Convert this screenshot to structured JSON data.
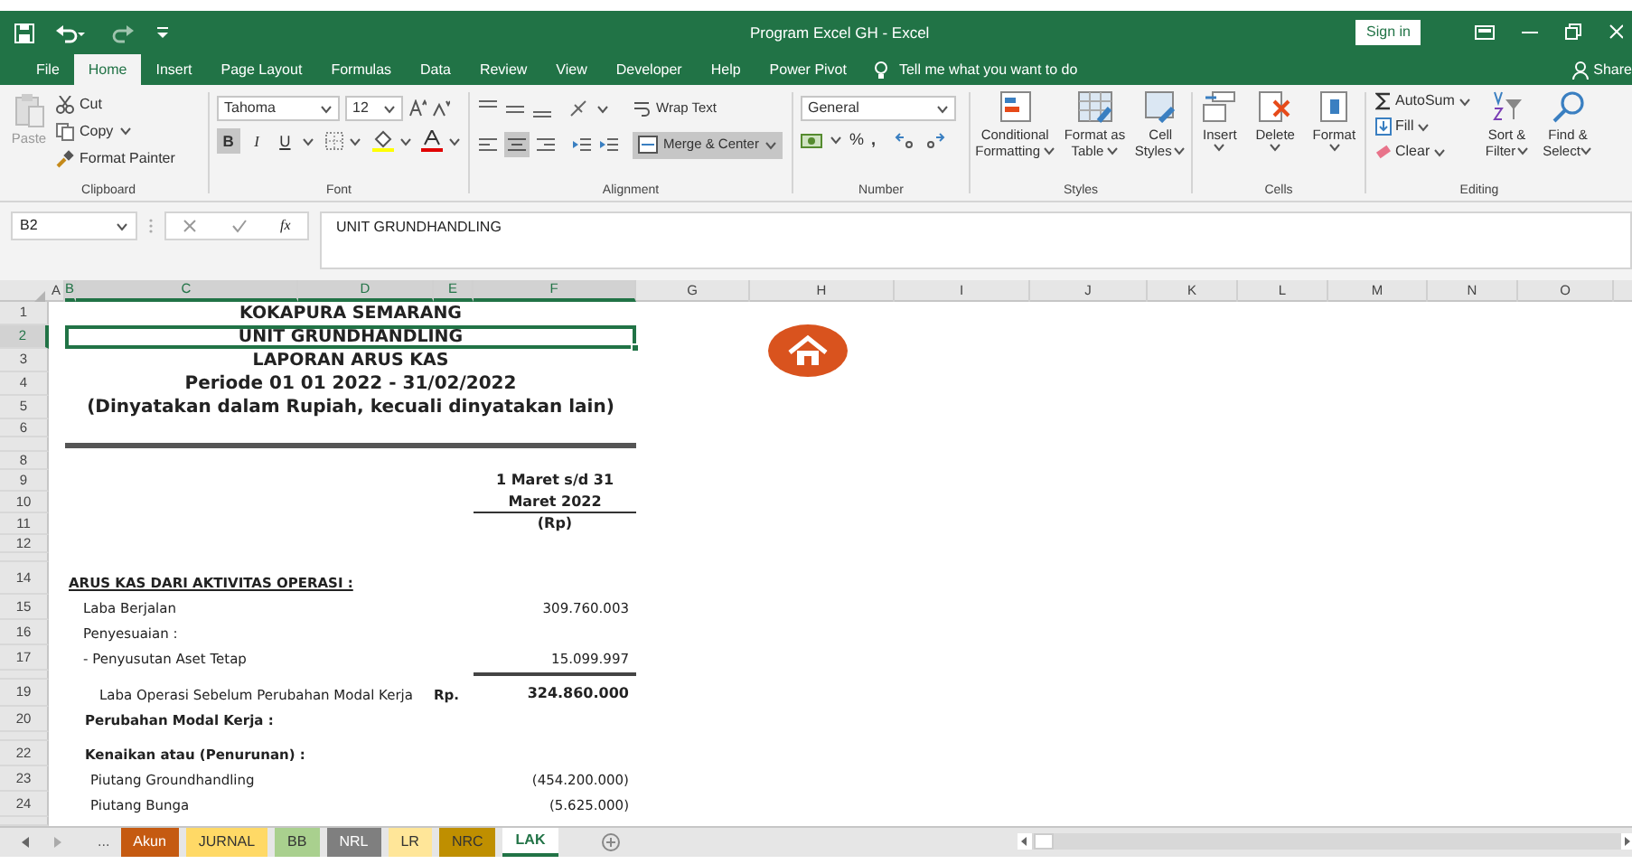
{
  "title_bar": {
    "title": "Program Excel GH  -  Excel",
    "sign_in": "Sign in"
  },
  "menu_tabs": [
    {
      "label": "File",
      "selected": false
    },
    {
      "label": "Home",
      "selected": true
    },
    {
      "label": "Insert",
      "selected": false
    },
    {
      "label": "Page Layout",
      "selected": false
    },
    {
      "label": "Formulas",
      "selected": false
    },
    {
      "label": "Data",
      "selected": false
    },
    {
      "label": "Review",
      "selected": false
    },
    {
      "label": "View",
      "selected": false
    },
    {
      "label": "Developer",
      "selected": false
    },
    {
      "label": "Help",
      "selected": false
    },
    {
      "label": "Power Pivot",
      "selected": false
    }
  ],
  "tell_me": "Tell me what you want to do",
  "share": "Share",
  "ribbon": {
    "clipboard": {
      "paste": "Paste",
      "cut": "Cut",
      "copy": "Copy",
      "format_painter": "Format Painter",
      "label": "Clipboard"
    },
    "font": {
      "name": "Tahoma",
      "size": "12",
      "bold": {
        "label": "B",
        "on": true
      },
      "italic": {
        "label": "I",
        "on": false
      },
      "underline": {
        "label": "U",
        "on": false
      },
      "label": "Font"
    },
    "alignment": {
      "center": {
        "on": true
      },
      "wrap_text": "Wrap Text",
      "merge": {
        "label": "Merge & Center",
        "on": true
      },
      "label": "Alignment"
    },
    "number": {
      "format": "General",
      "percent": "%",
      "comma": ",",
      "label": "Number"
    },
    "styles": {
      "buttons": [
        {
          "lines": [
            "Conditional",
            "Formatting"
          ]
        },
        {
          "lines": [
            "Format as",
            "Table"
          ]
        },
        {
          "lines": [
            "Cell",
            "Styles"
          ]
        }
      ],
      "label": "Styles"
    },
    "cells": {
      "buttons": [
        "Insert",
        "Delete",
        "Format"
      ],
      "label": "Cells"
    },
    "editing": {
      "autosum": "AutoSum",
      "fill": "Fill",
      "clear": "Clear",
      "sort": [
        "Sort &",
        "Filter"
      ],
      "find": [
        "Find &",
        "Select"
      ],
      "label": "Editing"
    }
  },
  "formula_bar": {
    "name_box": "B2",
    "function_label": "fx",
    "value": "UNIT GRUNDHANDLING"
  },
  "columns": [
    {
      "label": "A",
      "selected": false
    },
    {
      "label": "B",
      "selected": true
    },
    {
      "label": "C",
      "selected": true
    },
    {
      "label": "D",
      "selected": true
    },
    {
      "label": "E",
      "selected": true
    },
    {
      "label": "F",
      "selected": true
    },
    {
      "label": "G",
      "selected": false
    },
    {
      "label": "H",
      "selected": false
    },
    {
      "label": "I",
      "selected": false
    },
    {
      "label": "J",
      "selected": false
    },
    {
      "label": "K",
      "selected": false
    },
    {
      "label": "L",
      "selected": false
    },
    {
      "label": "M",
      "selected": false
    },
    {
      "label": "N",
      "selected": false
    },
    {
      "label": "O",
      "selected": false
    }
  ],
  "rows": [
    {
      "number": "1",
      "kind": "title",
      "text": "KOKAPURA SEMARANG",
      "selected": false
    },
    {
      "number": "2",
      "kind": "title",
      "text": "UNIT GRUNDHANDLING",
      "selected": true
    },
    {
      "number": "3",
      "kind": "title",
      "text": "LAPORAN ARUS KAS",
      "selected": false
    },
    {
      "number": "4",
      "kind": "title_large",
      "text": "Periode 01 01 2022 - 31/02/2022",
      "selected": false
    },
    {
      "number": "5",
      "kind": "title_large",
      "text": "(Dinyatakan dalam Rupiah, kecuali dinyatakan lain)",
      "selected": false
    },
    {
      "number": "6",
      "kind": "blank",
      "selected": false
    },
    {
      "kind": "double_rule",
      "selected": false
    },
    {
      "number": "8",
      "kind": "blank",
      "selected": false
    },
    {
      "number": "9",
      "kind": "column_heading",
      "text": "1 Maret s/d 31",
      "selected": false
    },
    {
      "number": "10",
      "kind": "column_heading_ruled",
      "text": "Maret 2022",
      "selected": false
    },
    {
      "number": "11",
      "kind": "column_heading",
      "text": "(Rp)",
      "selected": false
    },
    {
      "number": "12",
      "kind": "blank",
      "selected": false
    },
    {
      "kind": "thin",
      "selected": false
    },
    {
      "number": "14",
      "kind": "section",
      "label": "ARUS KAS DARI AKTIVITAS OPERASI :",
      "selected": false
    },
    {
      "number": "15",
      "kind": "item",
      "label": "Laba Berjalan",
      "amount": "309.760.003",
      "selected": false
    },
    {
      "number": "16",
      "kind": "item",
      "label": "Penyesuaian :",
      "selected": false
    },
    {
      "number": "17",
      "kind": "item",
      "label": "- Penyusutan Aset Tetap",
      "amount": "15.099.997",
      "selected": false
    },
    {
      "kind": "amount_rule",
      "selected": false
    },
    {
      "number": "19",
      "kind": "subtotal",
      "label": "Laba Operasi Sebelum Perubahan Modal Kerja",
      "unit": "Rp.",
      "amount": "324.860.000",
      "selected": false
    },
    {
      "number": "20",
      "kind": "subheading",
      "label": "Perubahan Modal Kerja :",
      "selected": false
    },
    {
      "kind": "thin",
      "selected": false
    },
    {
      "number": "22",
      "kind": "subheading",
      "label": "Kenaikan atau (Penurunan) :",
      "selected": false
    },
    {
      "number": "23",
      "kind": "sub_item",
      "label": "Piutang Groundhandling",
      "amount": "(454.200.000)",
      "selected": false
    },
    {
      "number": "24",
      "kind": "sub_item",
      "label": "Piutang Bunga",
      "amount": "(5.625.000)",
      "selected": false
    },
    {
      "kind": "thin",
      "selected": false
    }
  ],
  "sheet_tabs": {
    "more": "...",
    "tabs": [
      {
        "label": "Akun",
        "color": "#c55a11",
        "selected": false
      },
      {
        "label": "JURNAL",
        "color": "#ffd966",
        "selected": false
      },
      {
        "label": "BB",
        "color": "#a9d08e",
        "selected": false
      },
      {
        "label": "NRL",
        "color": "#7f7f7f",
        "selected": false
      },
      {
        "label": "LR",
        "color": "#ffe699",
        "selected": false
      },
      {
        "label": "NRC",
        "color": "#bf8f00",
        "selected": false
      },
      {
        "label": "LAK",
        "color": "#ffffff",
        "selected": true
      }
    ]
  }
}
